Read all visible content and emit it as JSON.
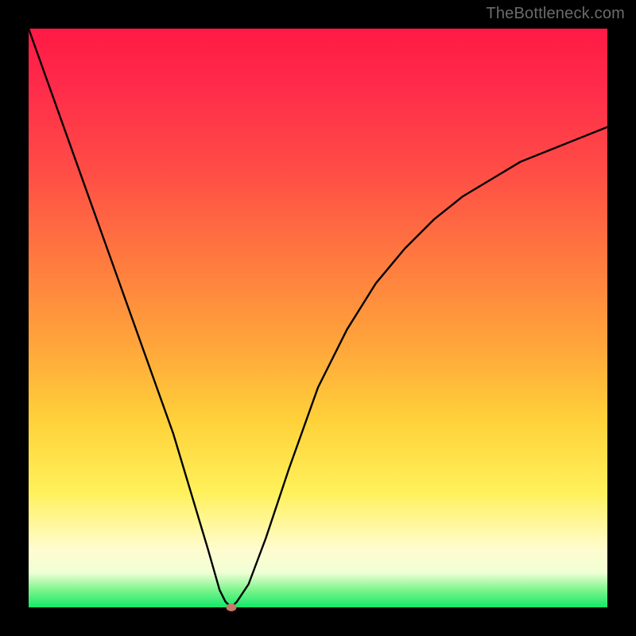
{
  "watermark": "TheBottleneck.com",
  "chart_data": {
    "type": "line",
    "title": "",
    "xlabel": "",
    "ylabel": "",
    "xlim": [
      0,
      100
    ],
    "ylim": [
      0,
      100
    ],
    "grid": false,
    "legend": false,
    "annotations": [],
    "background_gradient": [
      {
        "pos": 0,
        "color": "#ff1a45"
      },
      {
        "pos": 10,
        "color": "#ff2b4a"
      },
      {
        "pos": 25,
        "color": "#ff4e46"
      },
      {
        "pos": 40,
        "color": "#ff7a3f"
      },
      {
        "pos": 55,
        "color": "#ffa63b"
      },
      {
        "pos": 68,
        "color": "#ffd23a"
      },
      {
        "pos": 80,
        "color": "#fff15a"
      },
      {
        "pos": 90,
        "color": "#fffccf"
      },
      {
        "pos": 94,
        "color": "#f0ffd5"
      },
      {
        "pos": 97,
        "color": "#7cf58c"
      },
      {
        "pos": 100,
        "color": "#14e86a"
      }
    ],
    "series": [
      {
        "name": "bottleneck-curve",
        "x": [
          0,
          5,
          10,
          15,
          20,
          25,
          28,
          31,
          33,
          34,
          35,
          36,
          38,
          41,
          45,
          50,
          55,
          60,
          65,
          70,
          75,
          80,
          85,
          90,
          95,
          100
        ],
        "y": [
          100,
          86,
          72,
          58,
          44,
          30,
          20,
          10,
          3,
          1,
          0,
          1,
          4,
          12,
          24,
          38,
          48,
          56,
          62,
          67,
          71,
          74,
          77,
          79,
          81,
          83
        ]
      }
    ],
    "minimum_marker": {
      "x": 35,
      "y": 0,
      "color": "#c77a69"
    }
  }
}
